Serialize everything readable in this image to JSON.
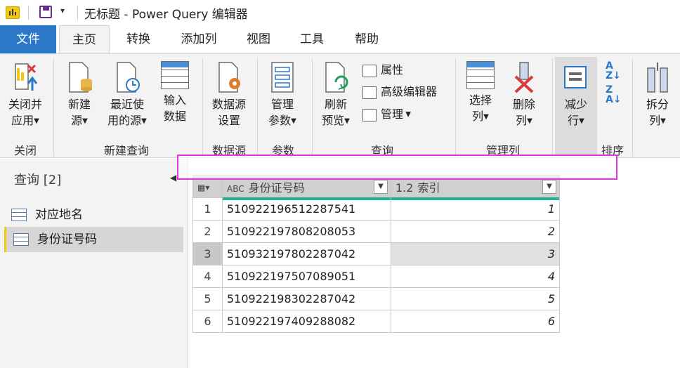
{
  "window": {
    "title": "无标题 - Power Query 编辑器"
  },
  "tabs": {
    "file": "文件",
    "home": "主页",
    "transform": "转换",
    "add_column": "添加列",
    "view": "视图",
    "tools": "工具",
    "help": "帮助"
  },
  "ribbon": {
    "close_apply": [
      "关闭并",
      "应用"
    ],
    "new_source": [
      "新建",
      "源"
    ],
    "recent_sources": [
      "最近使",
      "用的源"
    ],
    "enter_data": [
      "输入",
      "数据"
    ],
    "data_source_settings": [
      "数据源",
      "设置"
    ],
    "manage_params": [
      "管理",
      "参数"
    ],
    "refresh_preview": [
      "刷新",
      "预览"
    ],
    "properties": "属性",
    "advanced_editor": "高级编辑器",
    "manage": "管理",
    "choose_columns": [
      "选择",
      "列"
    ],
    "remove_columns": [
      "删除",
      "列"
    ],
    "reduce_rows": [
      "减少",
      "行"
    ],
    "split_column": [
      "拆分",
      "列"
    ],
    "groups": {
      "close": "关闭",
      "new_query": "新建查询",
      "data_sources": "数据源",
      "parameters": "参数",
      "query": "查询",
      "manage_columns": "管理列",
      "sort": "排序"
    }
  },
  "queries": {
    "header": "查询 [2]",
    "items": [
      "对应地名",
      "身份证号码"
    ]
  },
  "table": {
    "col1_type": "ABC",
    "col1": "身份证号码",
    "col2_type": "1.2",
    "col2": "索引",
    "rows": [
      [
        "1",
        "510922196512287541",
        "1"
      ],
      [
        "2",
        "510922197808208053",
        "2"
      ],
      [
        "3",
        "510932197802287042",
        "3"
      ],
      [
        "4",
        "510922197507089051",
        "4"
      ],
      [
        "5",
        "510922198302287042",
        "5"
      ],
      [
        "6",
        "510922197409288082",
        "6"
      ]
    ]
  },
  "colors": {
    "file_tab": "#2b78c8",
    "accent": "#f2c811",
    "quality_bar": "#1fb59a",
    "highlight": "#e036e0"
  }
}
